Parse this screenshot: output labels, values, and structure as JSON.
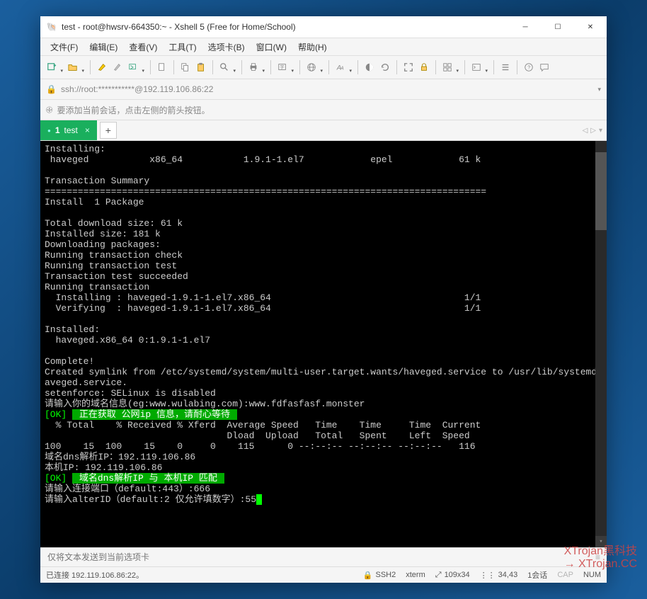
{
  "window": {
    "title": "test - root@hwsrv-664350:~ - Xshell 5 (Free for Home/School)"
  },
  "menubar": {
    "items": [
      "文件(F)",
      "编辑(E)",
      "查看(V)",
      "工具(T)",
      "选项卡(B)",
      "窗口(W)",
      "帮助(H)"
    ]
  },
  "addressbar": {
    "text": "ssh://root:***********@192.119.106.86:22"
  },
  "hintbar": {
    "text": "要添加当前会话，点击左侧的箭头按钮。"
  },
  "tabs": {
    "active": {
      "index": "1",
      "label": "test"
    }
  },
  "terminal": {
    "lines": [
      "Installing:",
      " haveged           x86_64           1.9.1-1.el7            epel            61 k",
      "",
      "Transaction Summary",
      "================================================================================",
      "Install  1 Package",
      "",
      "Total download size: 61 k",
      "Installed size: 181 k",
      "Downloading packages:",
      "Running transaction check",
      "Running transaction test",
      "Transaction test succeeded",
      "Running transaction",
      "  Installing : haveged-1.9.1-1.el7.x86_64                                   1/1",
      "  Verifying  : haveged-1.9.1-1.el7.x86_64                                   1/1",
      "",
      "Installed:",
      "  haveged.x86_64 0:1.9.1-1.el7",
      "",
      "Complete!",
      "Created symlink from /etc/systemd/system/multi-user.target.wants/haveged.service to /usr/lib/systemd/system/h",
      "aveged.service.",
      "setenforce: SELinux is disabled"
    ],
    "prompt_domain": "请输入你的域名信息(eg:www.wulabing.com):www.fdfasfasf.monster",
    "ok1_tag": "[OK]",
    "ok1_msg": " 正在获取 公网ip 信息，请耐心等待 ",
    "curl_head": "  % Total    % Received % Xferd  Average Speed   Time    Time     Time  Current",
    "curl_head2": "                                 Dload  Upload   Total   Spent    Left  Speed",
    "curl_line": "100    15  100    15    0     0    115      0 --:--:-- --:--:-- --:--:--   116",
    "dns_ip": "域名dns解析IP：192.119.106.86",
    "local_ip": "本机IP: 192.119.106.86",
    "ok2_tag": "[OK]",
    "ok2_msg": " 域名dns解析IP 与 本机IP 匹配 ",
    "prompt_port": "请输入连接端口（default:443）:666",
    "prompt_alterid_pre": "请输入alterID（default:2 仅允许填数字）:55",
    "cursor": " "
  },
  "sendbar": {
    "placeholder": "仅将文本发送到当前选项卡"
  },
  "statusbar": {
    "conn": "已连接 192.119.106.86:22。",
    "ssh": "SSH2",
    "term": "xterm",
    "size": "109x34",
    "pos": "34,43",
    "sess": "1会话",
    "caps": "CAP",
    "num": "NUM"
  },
  "watermark": {
    "line1": "XTrojan黑科技",
    "line2": "→ XTrojan.CC"
  }
}
